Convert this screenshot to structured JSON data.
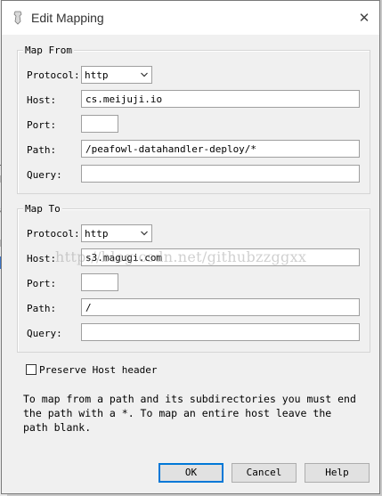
{
  "window": {
    "title": "Edit Mapping"
  },
  "map_from": {
    "legend": "Map From",
    "protocol_label": "Protocol:",
    "protocol_value": "http",
    "host_label": "Host:",
    "host_value": "cs.meijuji.io",
    "port_label": "Port:",
    "port_value": "",
    "path_label": "Path:",
    "path_value": "/peafowl-datahandler-deploy/*",
    "query_label": "Query:",
    "query_value": ""
  },
  "map_to": {
    "legend": "Map To",
    "protocol_label": "Protocol:",
    "protocol_value": "http",
    "host_label": "Host:",
    "host_value": "s3.magugi.com",
    "port_label": "Port:",
    "port_value": "",
    "path_label": "Path:",
    "path_value": "/",
    "query_label": "Query:",
    "query_value": ""
  },
  "preserve_host": {
    "label": "Preserve Host header",
    "checked": false
  },
  "help_text": "To map from a path and its subdirectories you must end\nthe path with a *. To map an entire host leave the\npath blank.",
  "buttons": {
    "ok": "OK",
    "cancel": "Cancel",
    "help": "Help"
  },
  "watermark": "http://blog.csdn.net/githubzzggxx",
  "background_fragments": [
    "f",
    "h",
    "a",
    "h"
  ],
  "icons": {
    "title": "app-icon",
    "close": "close-icon",
    "dropdown": "chevron-down-icon"
  },
  "colors": {
    "default_button_border": "#0078d7",
    "dialog_bg": "#f0f0f0"
  }
}
